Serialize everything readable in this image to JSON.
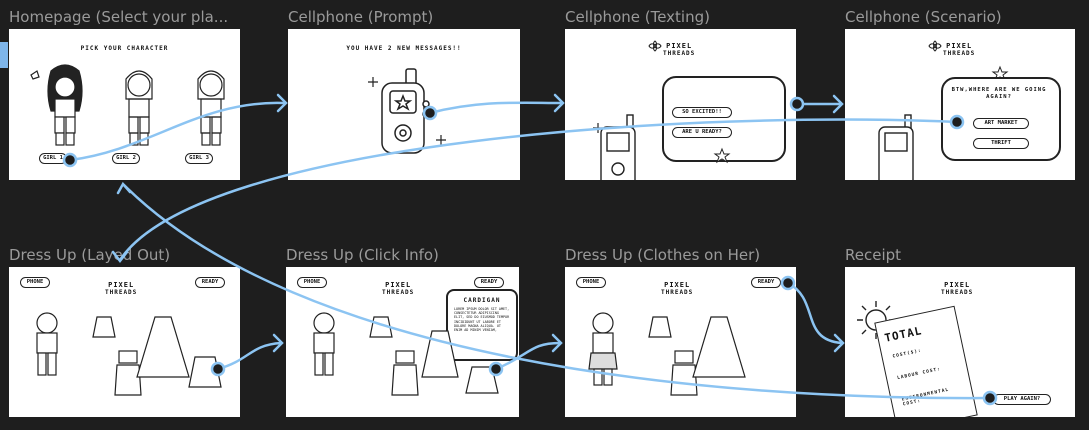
{
  "frames": [
    {
      "id": "homepage",
      "title": "Homepage (Select your pla..."
    },
    {
      "id": "prompt",
      "title": "Cellphone (Prompt)"
    },
    {
      "id": "texting",
      "title": "Cellphone (Texting)"
    },
    {
      "id": "scenario",
      "title": "Cellphone (Scenario)"
    },
    {
      "id": "layout",
      "title": "Dress Up (Layed Out)"
    },
    {
      "id": "clickinfo",
      "title": "Dress Up (Click Info)"
    },
    {
      "id": "clothes",
      "title": "Dress Up (Clothes on Her)"
    },
    {
      "id": "receipt",
      "title": "Receipt"
    }
  ],
  "homepage": {
    "heading": "PICK YOUR CHARACTER",
    "girls": [
      "GIRL 1",
      "GIRL 2",
      "GIRL 3"
    ]
  },
  "prompt": {
    "message": "YOU HAVE 2 NEW MESSAGES!!"
  },
  "logo": {
    "line1": "PIXEL",
    "line2": "THREADS"
  },
  "texting": {
    "replies": [
      "SO EXCITED!!",
      "ARE U READY?"
    ]
  },
  "scenario": {
    "question": "BTW,WHERE ARE WE GOING AGAIN?",
    "options": [
      "ART MARKET",
      "THRIFT"
    ]
  },
  "dressup": {
    "phone_label": "PHONE",
    "ready_label": "READY"
  },
  "clickinfo": {
    "item_title": "CARDIGAN",
    "item_desc": "LOREM IPSUM DOLOR SIT AMET, CONSECTETUR ADIPISCING ELIT, SED DO EIUSMOD TEMPOR INCIDIDUNT UT LABORE ET DOLORE MAGNA ALIQUA. UT ENIM AD MINIM VENIAM,"
  },
  "receipt": {
    "title": "TOTAL",
    "lines": [
      "COST($):",
      "LABOUR COST:",
      "ENVIRONMENTAL COST:"
    ],
    "play_again": "PLAY AGAIN?"
  },
  "colors": {
    "canvas": "#1e1e1e",
    "frame_title": "#9a9a9a",
    "wire": "#8cc4f2",
    "ink": "#222222"
  }
}
